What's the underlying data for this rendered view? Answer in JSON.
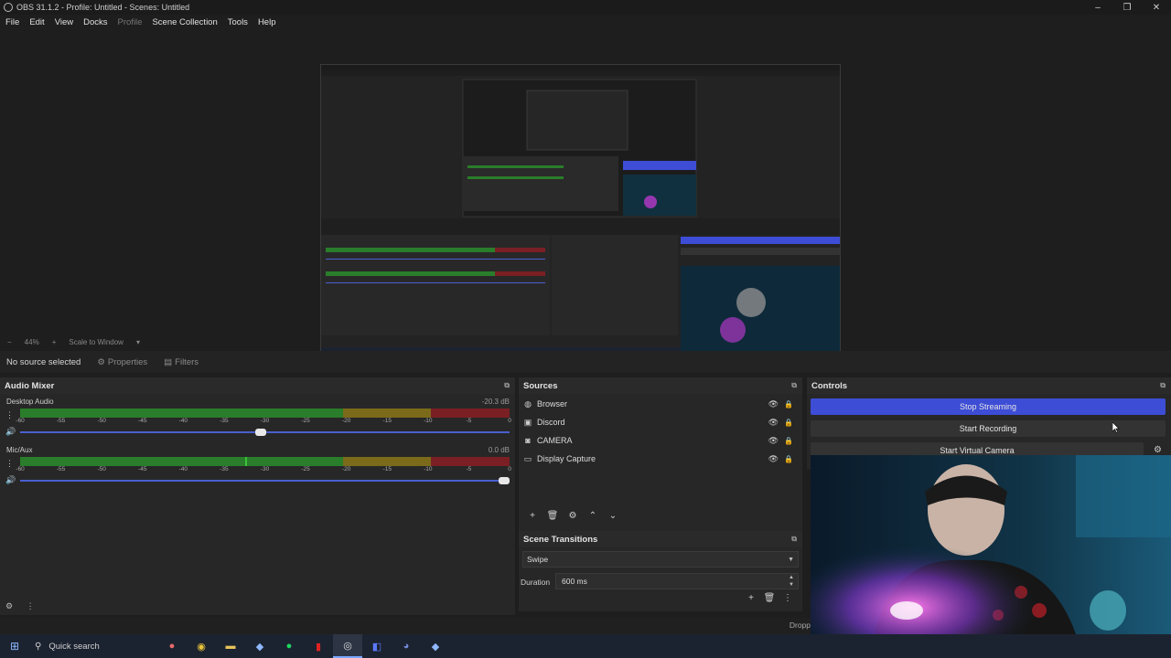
{
  "window": {
    "title": "OBS 31.1.2 - Profile: Untitled - Scenes: Untitled",
    "controls": [
      "–",
      "❐",
      "✕"
    ]
  },
  "menu": [
    "File",
    "Edit",
    "View",
    "Docks",
    "Profile",
    "Scene Collection",
    "Tools",
    "Help"
  ],
  "zoom": {
    "minus": "−",
    "level": "44%",
    "plus": "+",
    "mode": "Scale to Window"
  },
  "props_bar": {
    "selection": "No source selected",
    "properties": "Properties",
    "filters": "Filters"
  },
  "audio_mixer": {
    "title": "Audio Mixer",
    "ticks": [
      "-60",
      "-55",
      "-50",
      "-45",
      "-40",
      "-35",
      "-30",
      "-25",
      "-20",
      "-15",
      "-10",
      "-5",
      "0"
    ],
    "channels": [
      {
        "name": "Desktop Audio",
        "db": "-20.3 dB",
        "level": 0.0,
        "volume": 0.48
      },
      {
        "name": "Mic/Aux",
        "db": "0.0 dB",
        "level": 0.46,
        "volume": 1.0
      }
    ]
  },
  "sources": {
    "title": "Sources",
    "items": [
      {
        "name": "Browser",
        "icon": "globe-icon"
      },
      {
        "name": "Discord",
        "icon": "window-icon"
      },
      {
        "name": "CAMERA",
        "icon": "camera-icon"
      },
      {
        "name": "Display Capture",
        "icon": "monitor-icon"
      }
    ]
  },
  "transitions": {
    "title": "Scene Transitions",
    "selected": "Swipe",
    "duration_label": "Duration",
    "duration": "600 ms"
  },
  "controls": {
    "title": "Controls",
    "stop_streaming": "Stop Streaming",
    "start_recording": "Start Recording",
    "start_virtual_camera": "Start Virtual Camera"
  },
  "status": {
    "drop_text": "Dropp"
  },
  "taskbar": {
    "search": "Quick search",
    "apps": [
      "balloon-icon",
      "chrome-icon",
      "folder-icon",
      "steam-icon",
      "spotify-icon",
      "red-app-icon",
      "obs-icon",
      "game-icon",
      "discord-icon",
      "steam-2-icon"
    ]
  },
  "colors": {
    "accent": "#3d4dd6",
    "meter_green": "#2a7d2a",
    "meter_yellow": "#7b6a1a",
    "meter_red": "#7a1f24"
  }
}
